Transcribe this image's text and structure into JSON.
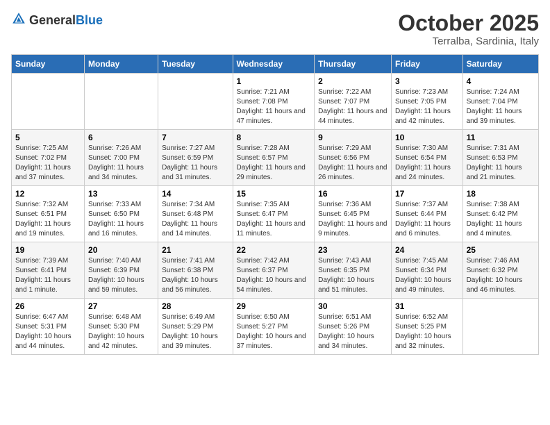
{
  "header": {
    "logo_general": "General",
    "logo_blue": "Blue",
    "month_title": "October 2025",
    "subtitle": "Terralba, Sardinia, Italy"
  },
  "days_of_week": [
    "Sunday",
    "Monday",
    "Tuesday",
    "Wednesday",
    "Thursday",
    "Friday",
    "Saturday"
  ],
  "weeks": [
    [
      {
        "day": "",
        "info": ""
      },
      {
        "day": "",
        "info": ""
      },
      {
        "day": "",
        "info": ""
      },
      {
        "day": "1",
        "info": "Sunrise: 7:21 AM\nSunset: 7:08 PM\nDaylight: 11 hours and 47 minutes."
      },
      {
        "day": "2",
        "info": "Sunrise: 7:22 AM\nSunset: 7:07 PM\nDaylight: 11 hours and 44 minutes."
      },
      {
        "day": "3",
        "info": "Sunrise: 7:23 AM\nSunset: 7:05 PM\nDaylight: 11 hours and 42 minutes."
      },
      {
        "day": "4",
        "info": "Sunrise: 7:24 AM\nSunset: 7:04 PM\nDaylight: 11 hours and 39 minutes."
      }
    ],
    [
      {
        "day": "5",
        "info": "Sunrise: 7:25 AM\nSunset: 7:02 PM\nDaylight: 11 hours and 37 minutes."
      },
      {
        "day": "6",
        "info": "Sunrise: 7:26 AM\nSunset: 7:00 PM\nDaylight: 11 hours and 34 minutes."
      },
      {
        "day": "7",
        "info": "Sunrise: 7:27 AM\nSunset: 6:59 PM\nDaylight: 11 hours and 31 minutes."
      },
      {
        "day": "8",
        "info": "Sunrise: 7:28 AM\nSunset: 6:57 PM\nDaylight: 11 hours and 29 minutes."
      },
      {
        "day": "9",
        "info": "Sunrise: 7:29 AM\nSunset: 6:56 PM\nDaylight: 11 hours and 26 minutes."
      },
      {
        "day": "10",
        "info": "Sunrise: 7:30 AM\nSunset: 6:54 PM\nDaylight: 11 hours and 24 minutes."
      },
      {
        "day": "11",
        "info": "Sunrise: 7:31 AM\nSunset: 6:53 PM\nDaylight: 11 hours and 21 minutes."
      }
    ],
    [
      {
        "day": "12",
        "info": "Sunrise: 7:32 AM\nSunset: 6:51 PM\nDaylight: 11 hours and 19 minutes."
      },
      {
        "day": "13",
        "info": "Sunrise: 7:33 AM\nSunset: 6:50 PM\nDaylight: 11 hours and 16 minutes."
      },
      {
        "day": "14",
        "info": "Sunrise: 7:34 AM\nSunset: 6:48 PM\nDaylight: 11 hours and 14 minutes."
      },
      {
        "day": "15",
        "info": "Sunrise: 7:35 AM\nSunset: 6:47 PM\nDaylight: 11 hours and 11 minutes."
      },
      {
        "day": "16",
        "info": "Sunrise: 7:36 AM\nSunset: 6:45 PM\nDaylight: 11 hours and 9 minutes."
      },
      {
        "day": "17",
        "info": "Sunrise: 7:37 AM\nSunset: 6:44 PM\nDaylight: 11 hours and 6 minutes."
      },
      {
        "day": "18",
        "info": "Sunrise: 7:38 AM\nSunset: 6:42 PM\nDaylight: 11 hours and 4 minutes."
      }
    ],
    [
      {
        "day": "19",
        "info": "Sunrise: 7:39 AM\nSunset: 6:41 PM\nDaylight: 11 hours and 1 minute."
      },
      {
        "day": "20",
        "info": "Sunrise: 7:40 AM\nSunset: 6:39 PM\nDaylight: 10 hours and 59 minutes."
      },
      {
        "day": "21",
        "info": "Sunrise: 7:41 AM\nSunset: 6:38 PM\nDaylight: 10 hours and 56 minutes."
      },
      {
        "day": "22",
        "info": "Sunrise: 7:42 AM\nSunset: 6:37 PM\nDaylight: 10 hours and 54 minutes."
      },
      {
        "day": "23",
        "info": "Sunrise: 7:43 AM\nSunset: 6:35 PM\nDaylight: 10 hours and 51 minutes."
      },
      {
        "day": "24",
        "info": "Sunrise: 7:45 AM\nSunset: 6:34 PM\nDaylight: 10 hours and 49 minutes."
      },
      {
        "day": "25",
        "info": "Sunrise: 7:46 AM\nSunset: 6:32 PM\nDaylight: 10 hours and 46 minutes."
      }
    ],
    [
      {
        "day": "26",
        "info": "Sunrise: 6:47 AM\nSunset: 5:31 PM\nDaylight: 10 hours and 44 minutes."
      },
      {
        "day": "27",
        "info": "Sunrise: 6:48 AM\nSunset: 5:30 PM\nDaylight: 10 hours and 42 minutes."
      },
      {
        "day": "28",
        "info": "Sunrise: 6:49 AM\nSunset: 5:29 PM\nDaylight: 10 hours and 39 minutes."
      },
      {
        "day": "29",
        "info": "Sunrise: 6:50 AM\nSunset: 5:27 PM\nDaylight: 10 hours and 37 minutes."
      },
      {
        "day": "30",
        "info": "Sunrise: 6:51 AM\nSunset: 5:26 PM\nDaylight: 10 hours and 34 minutes."
      },
      {
        "day": "31",
        "info": "Sunrise: 6:52 AM\nSunset: 5:25 PM\nDaylight: 10 hours and 32 minutes."
      },
      {
        "day": "",
        "info": ""
      }
    ]
  ]
}
